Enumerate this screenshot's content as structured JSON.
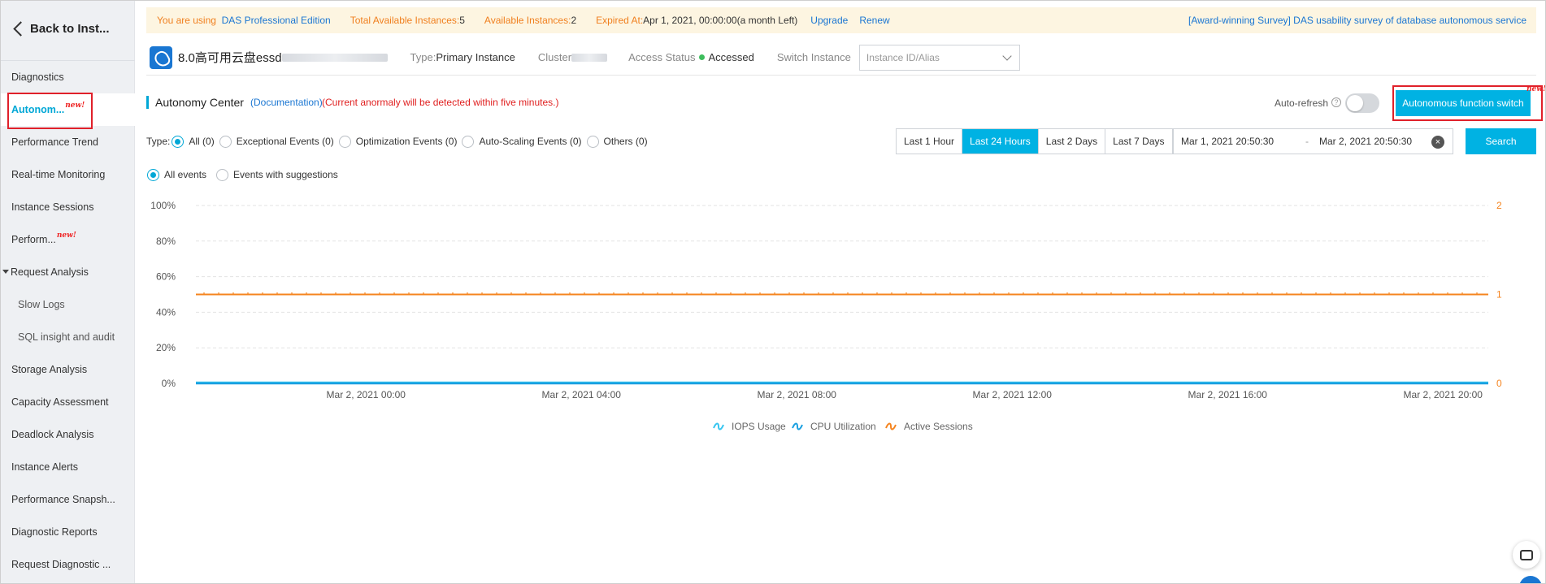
{
  "sidebar": {
    "back_label": "Back to Inst...",
    "items": [
      {
        "label": "Diagnostics",
        "active": false,
        "sub": false,
        "group": false,
        "badge": ""
      },
      {
        "label": "Autonom...",
        "active": true,
        "sub": false,
        "group": false,
        "badge": "new!"
      },
      {
        "label": "Performance Trend",
        "active": false,
        "sub": false,
        "group": false,
        "badge": ""
      },
      {
        "label": "Real-time Monitoring",
        "active": false,
        "sub": false,
        "group": false,
        "badge": ""
      },
      {
        "label": "Instance Sessions",
        "active": false,
        "sub": false,
        "group": false,
        "badge": ""
      },
      {
        "label": "Perform...",
        "active": false,
        "sub": false,
        "group": false,
        "badge": "new!"
      },
      {
        "label": "Request Analysis",
        "active": false,
        "sub": false,
        "group": true,
        "badge": ""
      },
      {
        "label": "Slow Logs",
        "active": false,
        "sub": true,
        "group": false,
        "badge": ""
      },
      {
        "label": "SQL insight and audit",
        "active": false,
        "sub": true,
        "group": false,
        "badge": ""
      },
      {
        "label": "Storage Analysis",
        "active": false,
        "sub": false,
        "group": false,
        "badge": ""
      },
      {
        "label": "Capacity Assessment",
        "active": false,
        "sub": false,
        "group": false,
        "badge": ""
      },
      {
        "label": "Deadlock Analysis",
        "active": false,
        "sub": false,
        "group": false,
        "badge": ""
      },
      {
        "label": "Instance Alerts",
        "active": false,
        "sub": false,
        "group": false,
        "badge": ""
      },
      {
        "label": "Performance Snapsh...",
        "active": false,
        "sub": false,
        "group": false,
        "badge": ""
      },
      {
        "label": "Diagnostic Reports",
        "active": false,
        "sub": false,
        "group": false,
        "badge": ""
      },
      {
        "label": "Request Diagnostic ...",
        "active": false,
        "sub": false,
        "group": false,
        "badge": ""
      }
    ]
  },
  "banner": {
    "using_label": "You are using",
    "edition": "DAS Professional Edition",
    "total_label": "Total Available Instances:",
    "total_value": "5",
    "available_label": "Available Instances:",
    "available_value": "2",
    "expired_label": "Expired At:",
    "expired_value": "Apr 1, 2021, 00:00:00(a month Left)",
    "upgrade": "Upgrade",
    "renew": "Renew",
    "survey": "[Award-winning Survey] DAS usability survey of database autonomous service"
  },
  "instance": {
    "name": "8.0高可用云盘essd",
    "type_label": "Type:",
    "type_value": "Primary Instance",
    "cluster_label": "Cluster",
    "access_label": "Access Status",
    "access_value": "Accessed",
    "switch_label": "Switch Instance",
    "switch_placeholder": "Instance ID/Alias"
  },
  "autonomy": {
    "title": "Autonomy Center",
    "doc_link": "(Documentation)",
    "warning": "(Current anormaly will be detected within five minutes.)",
    "auto_refresh_label": "Auto-refresh",
    "auto_refresh_on": false,
    "switch_button": "Autonomous function switch",
    "switch_badge": "new!"
  },
  "filters": {
    "type_label": "Type:",
    "types": [
      {
        "label": "All (0)",
        "checked": true
      },
      {
        "label": "Exceptional Events (0)",
        "checked": false
      },
      {
        "label": "Optimization Events (0)",
        "checked": false
      },
      {
        "label": "Auto-Scaling Events (0)",
        "checked": false
      },
      {
        "label": "Others (0)",
        "checked": false
      }
    ],
    "events": [
      {
        "label": "All events",
        "checked": true
      },
      {
        "label": "Events with suggestions",
        "checked": false
      }
    ],
    "ranges": [
      {
        "label": "Last 1 Hour",
        "active": false
      },
      {
        "label": "Last 24 Hours",
        "active": true
      },
      {
        "label": "Last 2 Days",
        "active": false
      },
      {
        "label": "Last 7 Days",
        "active": false
      }
    ],
    "date_start": "Mar 1, 2021 20:50:30",
    "date_sep": "-",
    "date_end": "Mar 2, 2021 20:50:30",
    "search_button": "Search"
  },
  "chart_data": {
    "type": "line",
    "title": "",
    "x_ticks": [
      "Mar 2, 2021 00:00",
      "Mar 2, 2021 04:00",
      "Mar 2, 2021 08:00",
      "Mar 2, 2021 12:00",
      "Mar 2, 2021 16:00",
      "Mar 2, 2021 20:00"
    ],
    "x_range": [
      "2021-03-01T20:50:30",
      "2021-03-02T20:50:30"
    ],
    "y_left_ticks": [
      "100%",
      "80%",
      "60%",
      "40%",
      "20%",
      "0%"
    ],
    "y_left_range": [
      0,
      100
    ],
    "y_right_ticks": [
      "2",
      "1",
      "0"
    ],
    "y_right_range": [
      0,
      2
    ],
    "grid": true,
    "legend_position": "bottom",
    "series": [
      {
        "name": "IOPS Usage",
        "axis": "left",
        "color": "#36c5f0",
        "constant_value": 0
      },
      {
        "name": "CPU Utilization",
        "axis": "left",
        "color": "#1a9fe0",
        "constant_value": 0
      },
      {
        "name": "Active Sessions",
        "axis": "right",
        "color": "#f5841f",
        "constant_value": 1
      }
    ]
  },
  "colors": {
    "accent": "#00b2e3",
    "link": "#1a76d2",
    "warning": "#e02020",
    "banner_label": "#f07f1e"
  }
}
